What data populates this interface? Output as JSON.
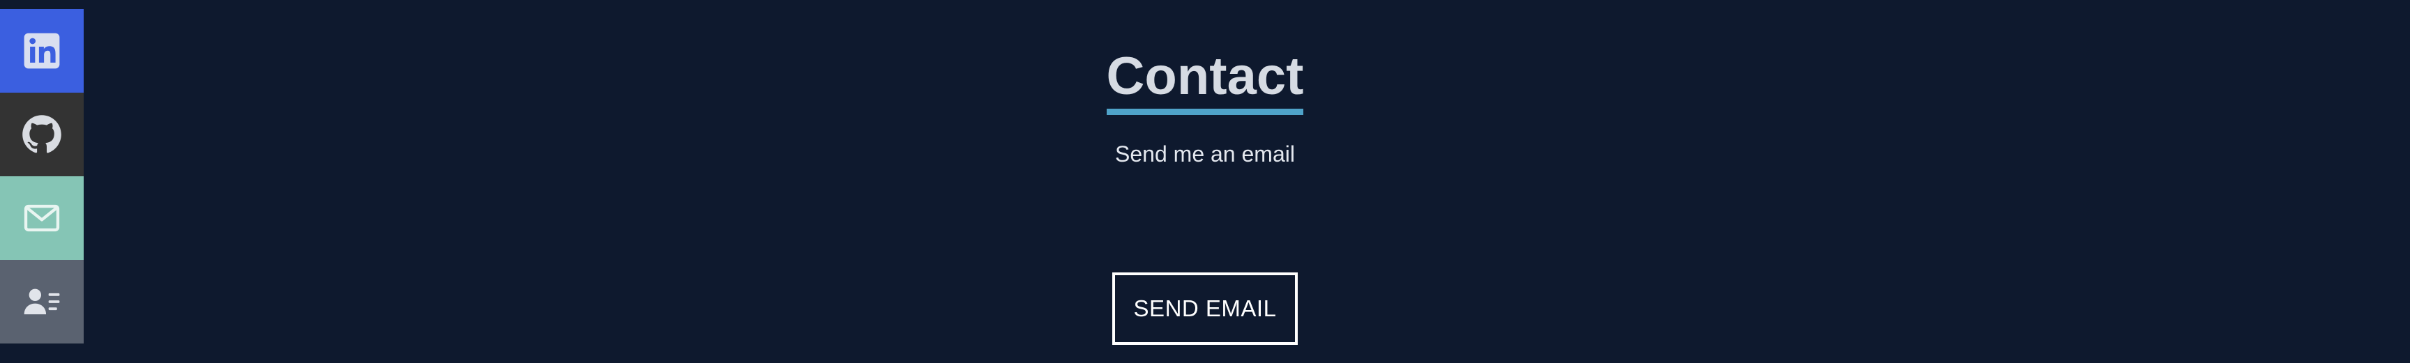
{
  "social_links": [
    {
      "icon": "linkedin-icon",
      "background": "#3b5fe0"
    },
    {
      "icon": "github-icon",
      "background": "#333333"
    },
    {
      "icon": "mail-icon",
      "background": "#85c5b5"
    },
    {
      "icon": "resume-icon",
      "background": "#5a6270"
    }
  ],
  "contact": {
    "title": "Contact",
    "subtitle": "Send me an email",
    "button_label": "SEND EMAIL"
  },
  "colors": {
    "page_background": "#0e192e",
    "title_text": "#d6dbe3",
    "title_underline": "#4fa3c9",
    "button_border": "#ffffff"
  }
}
